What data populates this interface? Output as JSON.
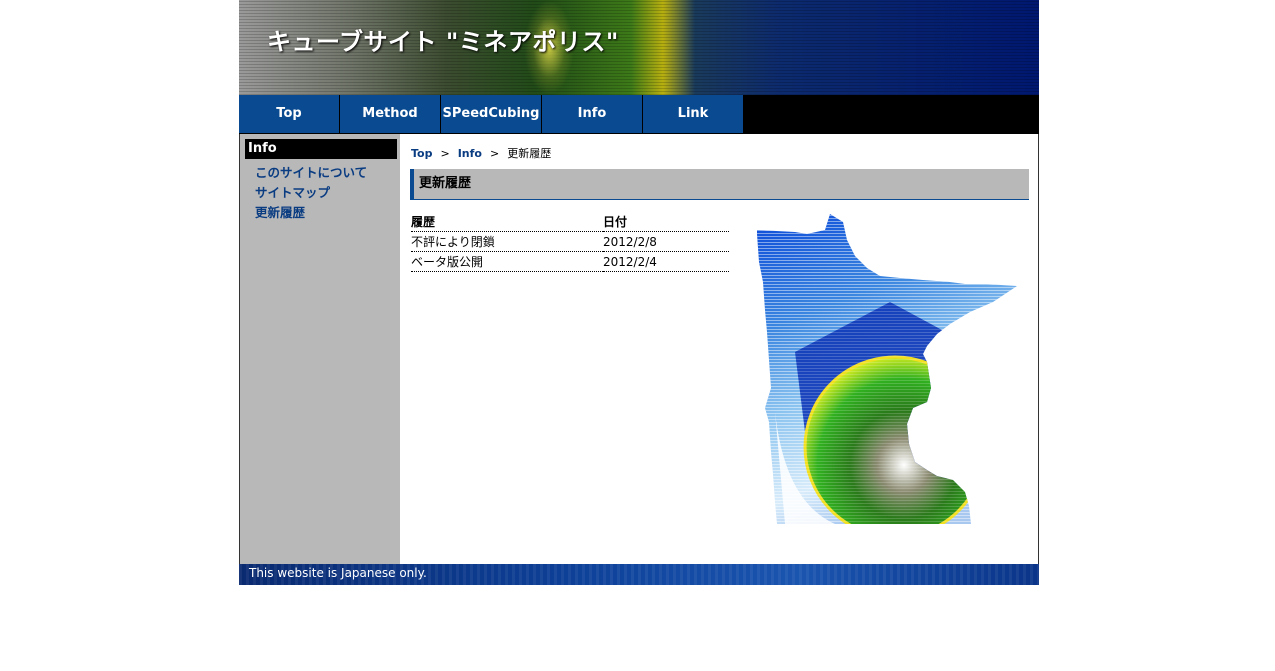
{
  "header": {
    "site_title": "キューブサイト \"ミネアポリス\""
  },
  "nav": {
    "items": [
      {
        "label": "Top"
      },
      {
        "label": "Method"
      },
      {
        "label": "SPeedCubing"
      },
      {
        "label": "Info"
      },
      {
        "label": "Link"
      }
    ]
  },
  "sidebar": {
    "heading": "Info",
    "links": [
      {
        "label": "このサイトについて"
      },
      {
        "label": "サイトマップ"
      },
      {
        "label": "更新履歴"
      }
    ]
  },
  "breadcrumb": {
    "items": [
      {
        "label": "Top"
      },
      {
        "label": "Info"
      },
      {
        "label": "更新履歴"
      }
    ],
    "separator": ">"
  },
  "main": {
    "section_title": "更新履歴",
    "table": {
      "headers": [
        "履歴",
        "日付"
      ],
      "rows": [
        [
          "不評により閉鎖",
          "2012/2/8"
        ],
        [
          "ベータ版公開",
          "2012/2/4"
        ]
      ]
    }
  },
  "footer": {
    "text": "This website is Japanese only."
  },
  "colors": {
    "nav_bg": "#0a4a90",
    "link": "#0a3c82",
    "sidebar_bg": "#b8b8b8",
    "section_border": "#0a4a90"
  }
}
